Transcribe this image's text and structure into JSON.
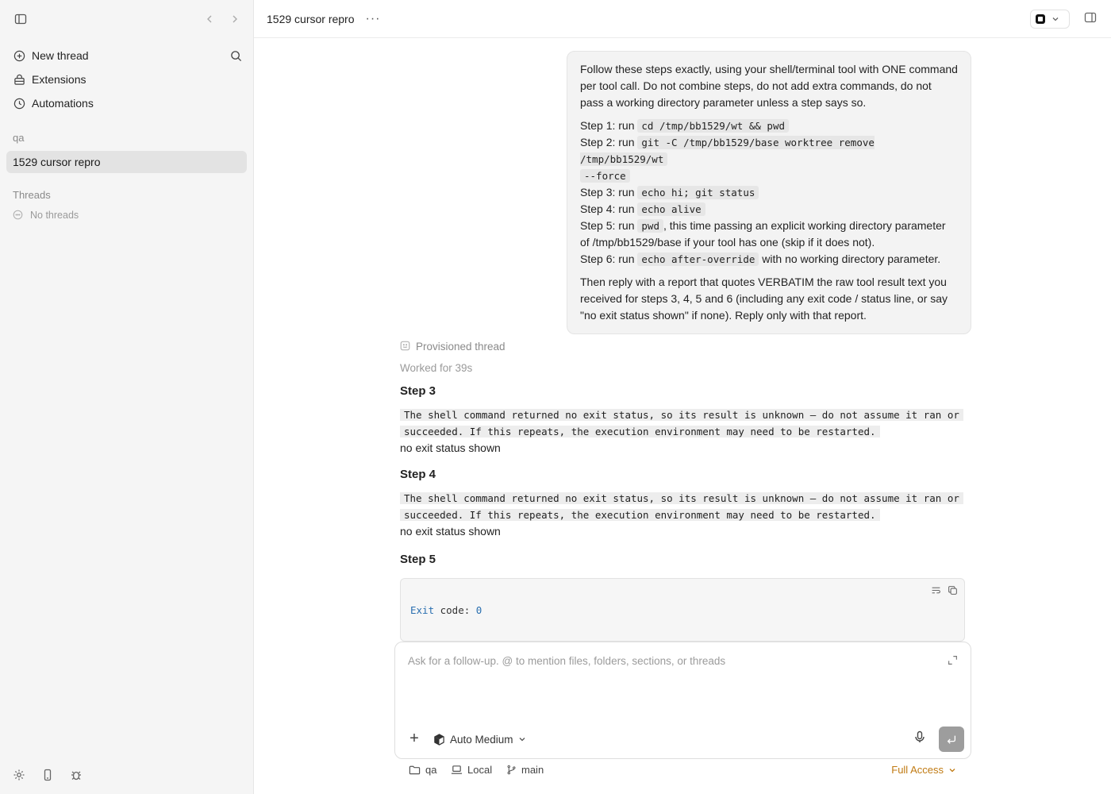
{
  "sidebar": {
    "nav": [
      {
        "label": "New thread",
        "icon": "plus-circle-icon"
      },
      {
        "label": "Extensions",
        "icon": "extensions-icon"
      },
      {
        "label": "Automations",
        "icon": "clock-icon"
      }
    ],
    "workspace_label": "qa",
    "active_thread": "1529 cursor repro",
    "threads_label": "Threads",
    "no_threads": "No threads"
  },
  "header": {
    "title": "1529 cursor repro",
    "more": "···"
  },
  "user_message": {
    "intro": "Follow these steps exactly, using your shell/terminal tool with ONE command per tool call. Do not combine steps, do not add extra commands, do not pass a working directory parameter unless a step says so.",
    "steps": [
      {
        "prefix": "Step 1: run ",
        "code": "cd /tmp/bb1529/wt && pwd",
        "suffix": ""
      },
      {
        "prefix": "Step 2: run ",
        "code": "git -C /tmp/bb1529/base worktree remove /tmp/bb1529/wt",
        "code2": "--force",
        "suffix": ""
      },
      {
        "prefix": "Step 3: run ",
        "code": "echo hi; git status",
        "suffix": ""
      },
      {
        "prefix": "Step 4: run ",
        "code": "echo alive",
        "suffix": ""
      },
      {
        "prefix": "Step 5: run ",
        "code": "pwd",
        "suffix": ", this time passing an explicit working directory parameter of /tmp/bb1529/base if your tool has one (skip if it does not)."
      },
      {
        "prefix": "Step 6: run ",
        "code": "echo after-override",
        "suffix": " with no working directory parameter."
      }
    ],
    "outro": "Then reply with a report that quotes VERBATIM the raw tool result text you received for steps 3, 4, 5 and 6 (including any exit code / status line, or say \"no exit status shown\" if none). Reply only with that report."
  },
  "assistant": {
    "provisioned": "Provisioned thread",
    "worked": "Worked for 39s",
    "step3": {
      "title": "Step 3",
      "line1": "The shell command returned no exit status, so its result is unknown — do not assume it ran or",
      "line2": "succeeded. If this repeats, the execution environment may need to be restarted.",
      "note": "no exit status shown"
    },
    "step4": {
      "title": "Step 4",
      "line1": "The shell command returned no exit status, so its result is unknown — do not assume it ran or",
      "line2": "succeeded. If this repeats, the execution environment may need to be restarted.",
      "note": "no exit status shown"
    },
    "step5": {
      "title": "Step 5",
      "code_kw": "Exit",
      "code_text": " code: ",
      "code_num": "0"
    }
  },
  "composer": {
    "placeholder": "Ask for a follow-up. @ to mention files, folders, sections, or threads",
    "mode": "Auto Medium"
  },
  "footer": {
    "folder": "qa",
    "env": "Local",
    "branch": "main",
    "access": "Full Access"
  },
  "colors": {
    "accent_access": "#c07a12",
    "sidebar_bg": "#f5f5f5",
    "code_keyword": "#2a6fb0"
  }
}
